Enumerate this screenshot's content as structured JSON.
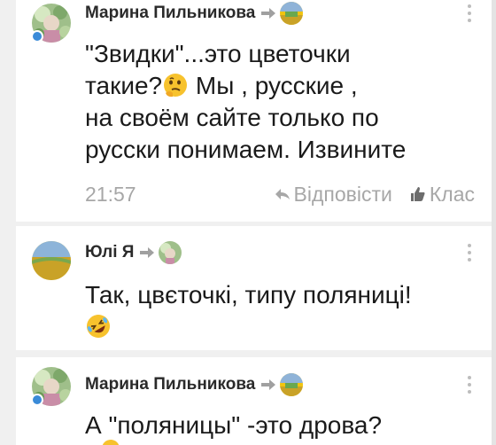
{
  "comments": [
    {
      "author": "Марина Пильникова",
      "message_lines": [
        "\"Звидки\"...это цветочки",
        "такие?",
        " Мы , русские ,",
        "на своём сайте только по",
        "русски понимаем. Извините"
      ],
      "time": "21:57",
      "reply_label": "Відповісти",
      "like_label": "Клас"
    },
    {
      "author": "Юлі Я",
      "message_lines": [
        "Так, цвєточкі, типу поляниці!"
      ]
    },
    {
      "author": "Марина Пильникова",
      "message_lines": [
        "А \"поляницы\" -это дрова?"
      ]
    }
  ],
  "colors": {
    "accent_blue": "#3a8bd8",
    "muted_text": "#a7a7a7",
    "background": "#f0f0f0",
    "card": "#ffffff"
  },
  "icons": {
    "reply": "reply-arrow-icon",
    "like": "thumbs-up-icon",
    "more": "more-vertical-icon",
    "share_arrow": "arrow-right-icon",
    "thinking_emoji": "thinking-face-emoji",
    "laughing_emoji": "rolling-laughing-emoji"
  }
}
